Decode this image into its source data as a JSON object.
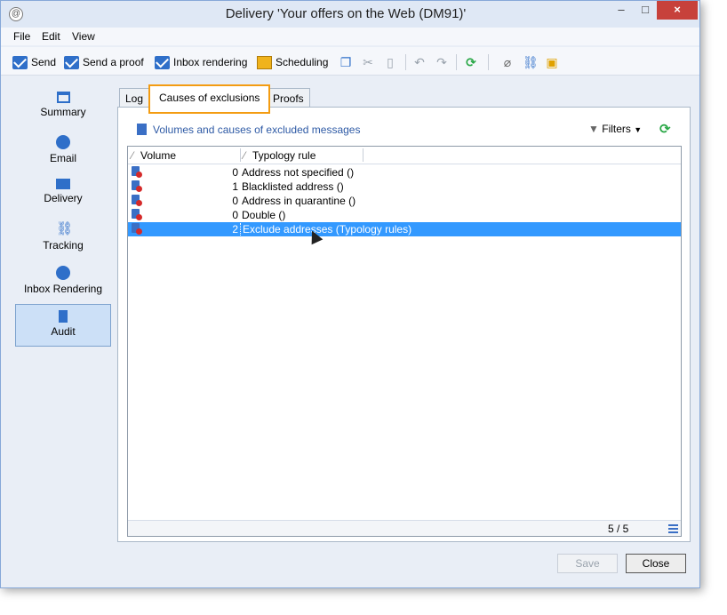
{
  "window": {
    "title": "Delivery 'Your offers on the Web (DM91)'",
    "close_label": "×",
    "minimize_label": "–",
    "maximize_label": "□"
  },
  "menu": [
    "File",
    "Edit",
    "View"
  ],
  "toolbar": {
    "send": "Send",
    "send_proof": "Send a proof",
    "inbox_rendering": "Inbox rendering",
    "scheduling": "Scheduling"
  },
  "sidebar": {
    "items": [
      {
        "label": "Summary",
        "icon": "summary-icon"
      },
      {
        "label": "Email",
        "icon": "email-icon"
      },
      {
        "label": "Delivery",
        "icon": "delivery-icon"
      },
      {
        "label": "Tracking",
        "icon": "tracking-icon"
      },
      {
        "label": "Inbox Rendering",
        "icon": "globe-icon"
      },
      {
        "label": "Audit",
        "icon": "audit-icon",
        "active": true
      }
    ]
  },
  "tabs": [
    {
      "label": "Log"
    },
    {
      "label": "Causes of exclusions",
      "active": true
    },
    {
      "label": "Proofs"
    }
  ],
  "panel": {
    "title": "Volumes and causes of excluded messages",
    "filters": "Filters"
  },
  "grid": {
    "columns": [
      "Volume",
      "Typology rule"
    ],
    "rows": [
      {
        "volume": "0",
        "rule": "Address not specified ()"
      },
      {
        "volume": "1",
        "rule": "Blacklisted address ()"
      },
      {
        "volume": "0",
        "rule": "Address in quarantine ()"
      },
      {
        "volume": "0",
        "rule": "Double ()"
      },
      {
        "volume": "2",
        "rule": "Exclude addresses (Typology rules)",
        "selected": true
      }
    ],
    "count": "5 / 5"
  },
  "buttons": {
    "save": "Save",
    "close": "Close"
  },
  "colors": {
    "accent": "#3399ff",
    "tab_highlight": "#f39c12",
    "link": "#2e5aa5"
  }
}
